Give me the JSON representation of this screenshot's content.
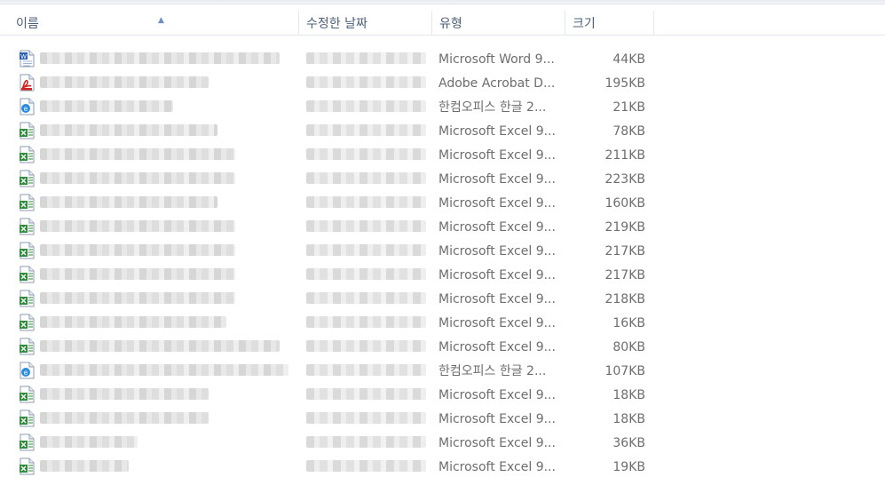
{
  "columns": {
    "name": "이름",
    "date": "수정한 날짜",
    "type": "유형",
    "size": "크기"
  },
  "colors": {
    "header_text": "#4c607a",
    "cell_text": "#6d6d6d",
    "excel_green": "#2e8b3a",
    "word_blue": "#2a5fb4",
    "pdf_red": "#d0261d",
    "hwp_blue": "#2b8be0"
  },
  "rows": [
    {
      "icon": "word-doc-icon",
      "type": "Microsoft Word 9...",
      "size": "44KB"
    },
    {
      "icon": "pdf-icon",
      "type": "Adobe Acrobat D...",
      "size": "195KB"
    },
    {
      "icon": "hwp-doc-icon",
      "type": "한컴오피스 한글 2...",
      "size": "21KB"
    },
    {
      "icon": "excel-doc-icon",
      "type": "Microsoft Excel 9...",
      "size": "78KB"
    },
    {
      "icon": "excel-doc-icon",
      "type": "Microsoft Excel 9...",
      "size": "211KB"
    },
    {
      "icon": "excel-doc-icon",
      "type": "Microsoft Excel 9...",
      "size": "223KB"
    },
    {
      "icon": "excel-doc-icon",
      "type": "Microsoft Excel 9...",
      "size": "160KB"
    },
    {
      "icon": "excel-doc-icon",
      "type": "Microsoft Excel 9...",
      "size": "219KB"
    },
    {
      "icon": "excel-doc-icon",
      "type": "Microsoft Excel 9...",
      "size": "217KB"
    },
    {
      "icon": "excel-doc-icon",
      "type": "Microsoft Excel 9...",
      "size": "217KB"
    },
    {
      "icon": "excel-doc-icon",
      "type": "Microsoft Excel 9...",
      "size": "218KB"
    },
    {
      "icon": "excel-doc-icon",
      "type": "Microsoft Excel 9...",
      "size": "16KB"
    },
    {
      "icon": "excel-doc-icon",
      "type": "Microsoft Excel 9...",
      "size": "80KB"
    },
    {
      "icon": "hwp-doc-icon",
      "type": "한컴오피스 한글 2...",
      "size": "107KB"
    },
    {
      "icon": "excel-doc-icon",
      "type": "Microsoft Excel 9...",
      "size": "18KB"
    },
    {
      "icon": "excel-doc-icon",
      "type": "Microsoft Excel 9...",
      "size": "18KB"
    },
    {
      "icon": "excel-doc-icon",
      "type": "Microsoft Excel 9...",
      "size": "36KB"
    },
    {
      "icon": "excel-doc-icon",
      "type": "Microsoft Excel 9...",
      "size": "19KB"
    }
  ]
}
